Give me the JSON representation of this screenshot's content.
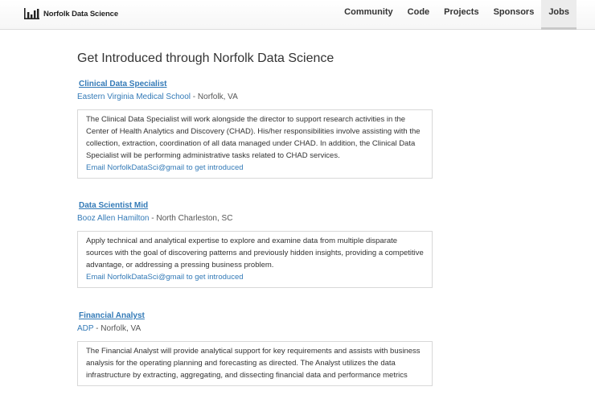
{
  "header": {
    "brand": "Norfolk Data Science",
    "brand_icon": "bar-chart-icon",
    "nav": [
      {
        "label": "Community"
      },
      {
        "label": "Code"
      },
      {
        "label": "Projects"
      },
      {
        "label": "Sponsors"
      },
      {
        "label": "Jobs",
        "active": true
      }
    ]
  },
  "main": {
    "title": "Get Introduced through Norfolk Data Science",
    "jobs": [
      {
        "title": "Clinical Data Specialist",
        "org": "Eastern Virginia Medical School",
        "location": "Norfolk, VA",
        "description": "The Clinical Data Specialist will work alongside the director to support research activities in the Center of Health Analytics and Discovery (CHAD). His/her responsibilities involve assisting with the collection, extraction, coordination of all data managed under CHAD. In addition, the Clinical Data Specialist will be performing administrative tasks related to CHAD services.",
        "contact": "Email NorfolkDataSci@gmail to get introduced"
      },
      {
        "title": "Data Scientist Mid",
        "org": "Booz Allen Hamilton",
        "location": "North Charleston, SC",
        "description": "Apply technical and analytical expertise to explore and examine data from multiple disparate sources with the goal of discovering patterns and previously hidden insights, providing a competitive advantage, or addressing a pressing business problem.",
        "contact": "Email NorfolkDataSci@gmail to get introduced"
      },
      {
        "title": "Financial Analyst",
        "org": "ADP",
        "location": "Norfolk, VA",
        "description": "The Financial Analyst will provide analytical support for key requirements and assists with business analysis for the operating planning and forecasting as directed. The Analyst utilizes the data infrastructure by extracting, aggregating, and dissecting financial data and performance metrics",
        "contact": ""
      }
    ]
  },
  "colors": {
    "link": "#337ab7",
    "text": "#333333",
    "card_border": "#d8d8d8"
  }
}
